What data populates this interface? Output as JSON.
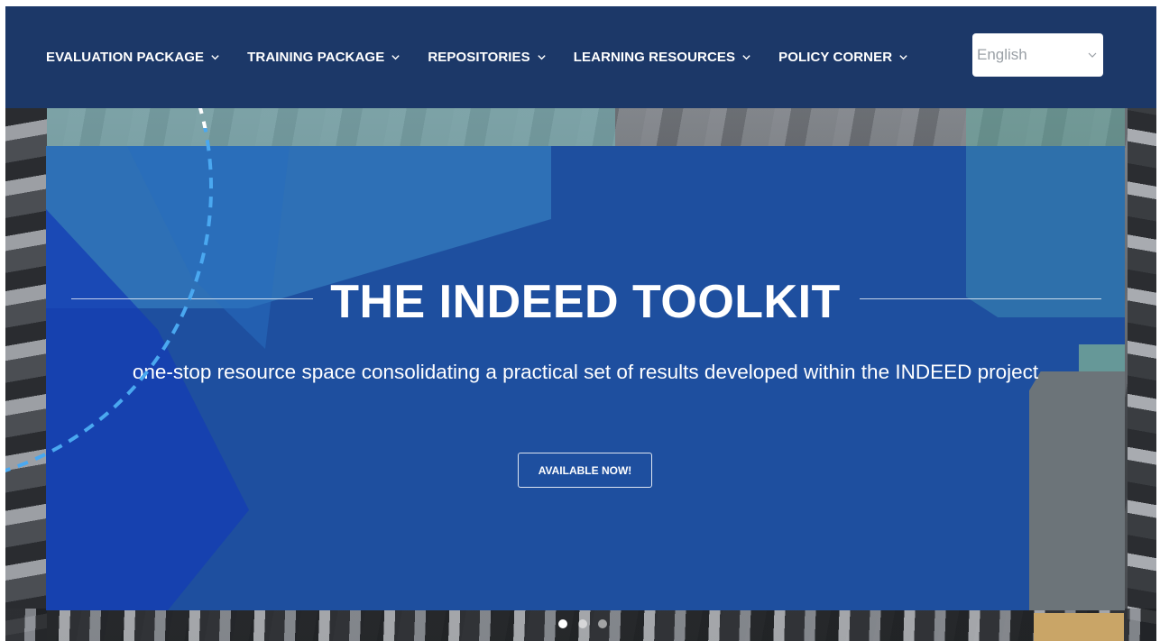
{
  "nav": {
    "items": [
      {
        "label": "EVALUATION PACKAGE"
      },
      {
        "label": "TRAINING PACKAGE"
      },
      {
        "label": "REPOSITORIES"
      },
      {
        "label": "LEARNING RESOURCES"
      },
      {
        "label": "POLICY CORNER"
      }
    ],
    "chevron_icon": "chevron-down-icon"
  },
  "language": {
    "selected": "English"
  },
  "hero": {
    "title": "THE INDEED TOOLKIT",
    "subtitle": "one-stop resource space consolidating a practical set of results developed within the INDEED project",
    "button_label": "AVAILABLE NOW!"
  },
  "slider": {
    "slide_count": 3,
    "active_index": 0
  },
  "colors": {
    "navbar": "#1c3868",
    "panel": "#1e4f9f",
    "accent_dash": "#4aa8f0"
  }
}
